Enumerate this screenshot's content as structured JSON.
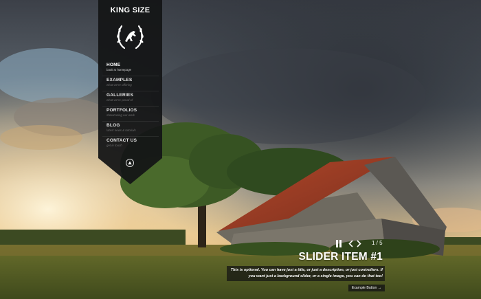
{
  "site": {
    "name": "KING SIZE"
  },
  "nav": {
    "items": [
      {
        "title": "HOME",
        "subtitle": "back to homepage",
        "active": true
      },
      {
        "title": "EXAMPLES",
        "subtitle": "what we're offering",
        "active": false
      },
      {
        "title": "GALLERIES",
        "subtitle": "what we're proud of",
        "active": false
      },
      {
        "title": "PORTFOLIOS",
        "subtitle": "showcasing our work",
        "active": false
      },
      {
        "title": "BLOG",
        "subtitle": "latest news & tutorials",
        "active": false
      },
      {
        "title": "CONTACT US",
        "subtitle": "get in touch",
        "active": false
      }
    ]
  },
  "slider": {
    "counter": "1 / 5",
    "title": "SLIDER ITEM #1",
    "description": "This is optional. You can have just a title, or just a description, or just controllers. If you want just a background slider, or a single image, you can do that too!",
    "button": "Example Button →"
  },
  "icons": {
    "logo": "laurel-wreath-horse-icon",
    "nav_toggle": "circle-arrow-up-icon",
    "pause": "pause-icon",
    "prev": "chevron-left-icon",
    "next": "chevron-right-icon"
  },
  "colors": {
    "panel": "#141516",
    "accent": "#ffffff"
  }
}
